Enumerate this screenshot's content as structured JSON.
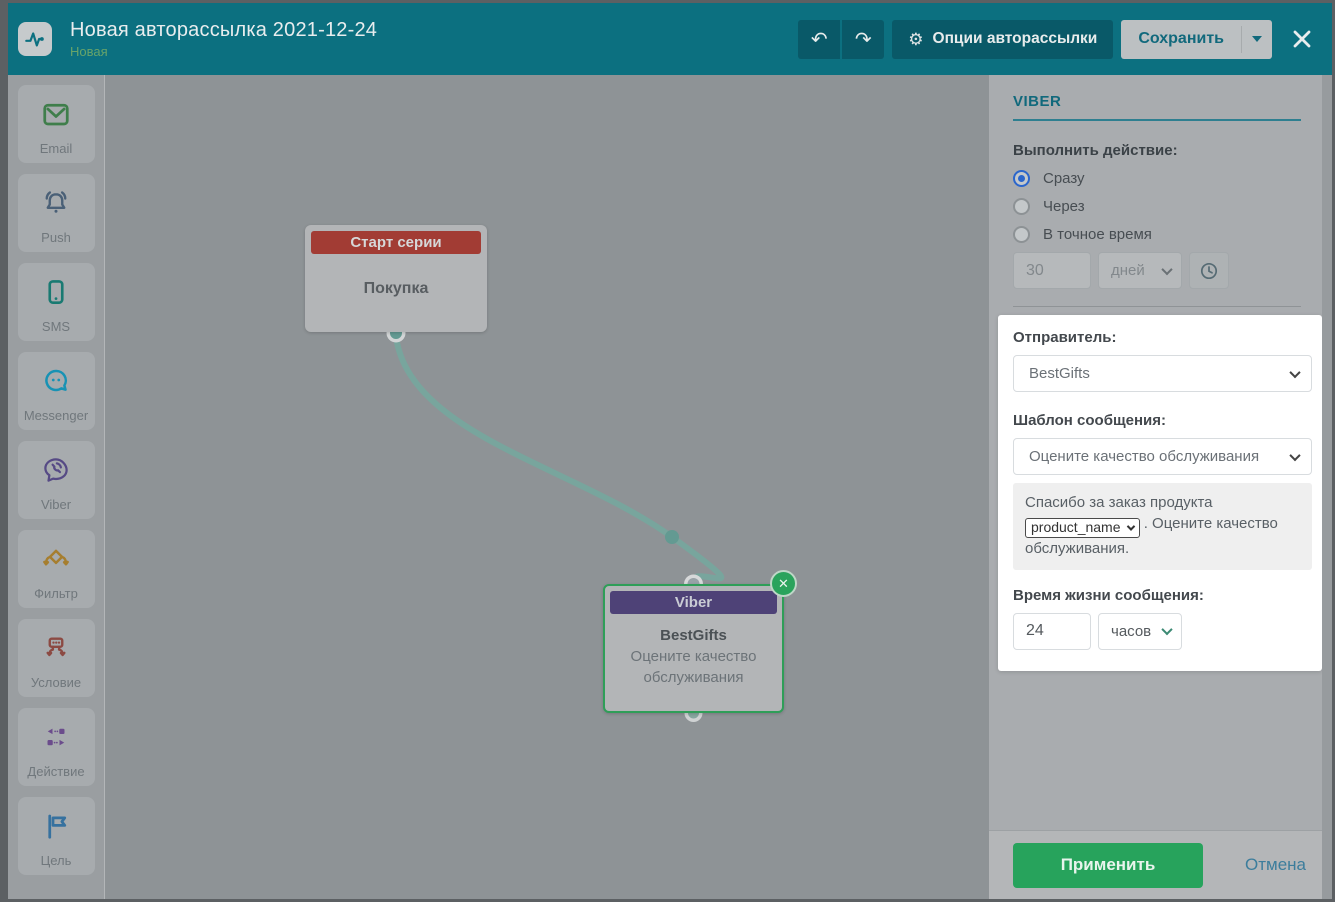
{
  "header": {
    "title": "Новая авторассылка 2021-12-24",
    "subtitle": "Новая",
    "options_button": "Опции авторассылки",
    "save_button": "Сохранить"
  },
  "sidebar": {
    "items": [
      {
        "key": "email",
        "label": "Email",
        "icon": "email-icon",
        "color": "#3f7e4b"
      },
      {
        "key": "push",
        "label": "Push",
        "icon": "push-bell-icon",
        "color": "#4a6077"
      },
      {
        "key": "sms",
        "label": "SMS",
        "icon": "sms-phone-icon",
        "color": "#197a72"
      },
      {
        "key": "messenger",
        "label": "Messenger",
        "icon": "messenger-icon",
        "color": "#1892b4"
      },
      {
        "key": "viber",
        "label": "Viber",
        "icon": "viber-icon",
        "color": "#564a85"
      },
      {
        "key": "filter",
        "label": "Фильтр",
        "icon": "filter-icon",
        "color": "#a67e2f"
      },
      {
        "key": "condition",
        "label": "Условие",
        "icon": "condition-icon",
        "color": "#8c4a43"
      },
      {
        "key": "action",
        "label": "Действие",
        "icon": "action-icon",
        "color": "#6b4c8c"
      },
      {
        "key": "goal",
        "label": "Цель",
        "icon": "goal-flag-icon",
        "color": "#36719f"
      }
    ]
  },
  "canvas": {
    "start_node": {
      "header": "Старт серии",
      "body": "Покупка",
      "header_color": "#a23c34"
    },
    "viber_node": {
      "header": "Viber",
      "title": "BestGifts",
      "subtitle": "Оцените качество обслуживания",
      "header_color": "#4e4277",
      "selected_border": "#2f9e58"
    }
  },
  "panel": {
    "heading": "VIBER",
    "action_label": "Выполнить действие:",
    "radios": [
      {
        "label": "Сразу",
        "selected": true
      },
      {
        "label": "Через",
        "selected": false
      },
      {
        "label": "В точное время",
        "selected": false
      }
    ],
    "delay": {
      "value": "30",
      "unit": "дней"
    },
    "sender_label": "Отправитель:",
    "sender_value": "BestGifts",
    "template_label": "Шаблон сообщения:",
    "template_value": "Оцените качество обслуживания",
    "preview": {
      "before": "Спасибо за заказ продукта",
      "variable": "product_name",
      "after": ". Оцените качество обслуживания."
    },
    "ttl_label": "Время жизни сообщения:",
    "ttl": {
      "value": "24",
      "unit": "часов"
    },
    "apply_button": "Применить",
    "cancel_button": "Отмена"
  },
  "colors": {
    "header_teal": "#0c7080",
    "accent_teal": "#11697c",
    "apply_green": "#27a35c",
    "selection_green": "#2f9e58",
    "radio_blue": "#2b66cc",
    "wire_teal": "#78a59d"
  }
}
